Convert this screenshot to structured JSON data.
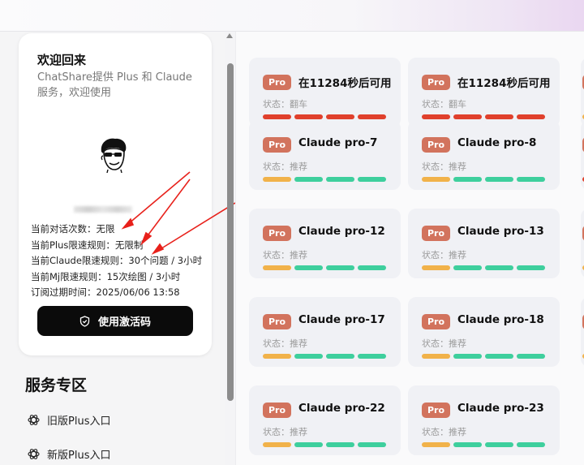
{
  "welcome": {
    "title": "欢迎回来",
    "description": "ChatShare提供 Plus 和 Claude 服务，欢迎使用",
    "stats": [
      "当前对话次数：无限",
      "当前Plus限速规则：无限制",
      "当前Claude限速规则：30个问题 / 3小时",
      "当前Mj限速规则：15次绘图 / 3小时",
      "订阅过期时间：2025/06/06 13:58"
    ],
    "activate_button": "使用激活码"
  },
  "services": {
    "title": "服务专区",
    "items": [
      {
        "label": "旧版Plus入口",
        "icon": "openai-icon"
      },
      {
        "label": "新版Plus入口",
        "icon": "openai-icon"
      }
    ]
  },
  "colors": {
    "badge": "#d2735d",
    "red": "#e0402c",
    "yellow": "#f1b24a",
    "green": "#3ecf9d",
    "button": "#0b0b0b"
  },
  "cards": [
    {
      "badge": "Pro",
      "name": "在11284秒后可用",
      "status": "状态：翻车",
      "bars": [
        "red",
        "red",
        "red",
        "red"
      ]
    },
    {
      "badge": "Pro",
      "name": "在11284秒后可用",
      "status": "状态：翻车",
      "bars": [
        "red",
        "red",
        "red",
        "red"
      ]
    },
    {
      "badge": "Pro",
      "name": "Claude pro-7",
      "status": "状态：推荐",
      "bars": [
        "yellow",
        "green",
        "green",
        "green"
      ]
    },
    {
      "badge": "Pro",
      "name": "Claude pro-8",
      "status": "状态：推荐",
      "bars": [
        "yellow",
        "green",
        "green",
        "green"
      ]
    },
    {
      "badge": "Pro",
      "name": "Claude pro-12",
      "status": "状态：推荐",
      "bars": [
        "yellow",
        "green",
        "green",
        "green"
      ]
    },
    {
      "badge": "Pro",
      "name": "Claude pro-13",
      "status": "状态：推荐",
      "bars": [
        "yellow",
        "green",
        "green",
        "green"
      ]
    },
    {
      "badge": "Pro",
      "name": "Claude pro-17",
      "status": "状态：推荐",
      "bars": [
        "yellow",
        "green",
        "green",
        "green"
      ]
    },
    {
      "badge": "Pro",
      "name": "Claude pro-18",
      "status": "状态：推荐",
      "bars": [
        "yellow",
        "green",
        "green",
        "green"
      ]
    },
    {
      "badge": "Pro",
      "name": "Claude pro-22",
      "status": "状态：推荐",
      "bars": [
        "yellow",
        "green",
        "green",
        "green"
      ]
    },
    {
      "badge": "Pro",
      "name": "Claude pro-23",
      "status": "状态：推荐",
      "bars": [
        "yellow",
        "green",
        "green",
        "green"
      ]
    }
  ],
  "partial_cards": [
    {
      "bar": "yellow"
    },
    {
      "bar": "red"
    },
    {
      "bar": "yellow"
    },
    {
      "bar": "yellow"
    }
  ]
}
